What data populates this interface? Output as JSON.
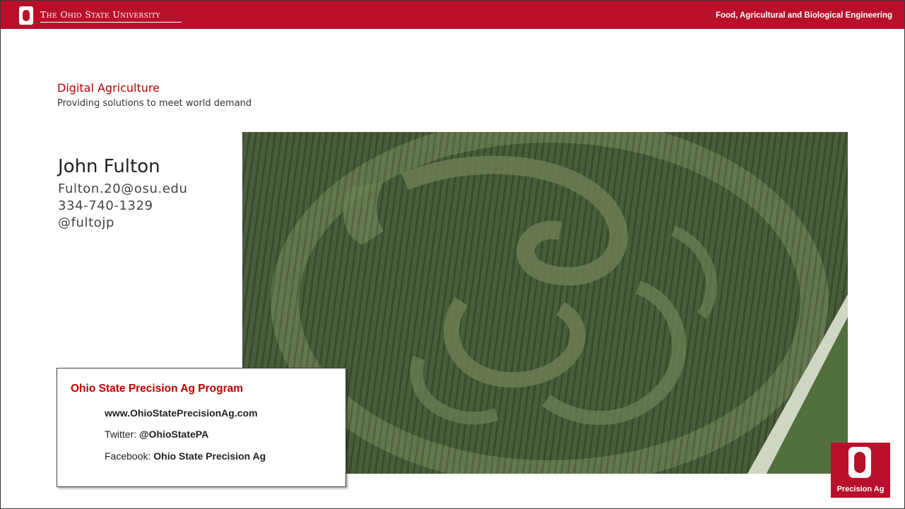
{
  "header": {
    "university": "The Ohio State University",
    "department": "Food, Agricultural and Biological Engineering"
  },
  "slide": {
    "title": "Digital Agriculture",
    "subtitle": "Providing solutions to meet world demand"
  },
  "contact": {
    "name": "John Fulton",
    "email": "Fulton.20@osu.edu",
    "phone": "334-740-1329",
    "handle": "@fultojp"
  },
  "program": {
    "heading": "Ohio State Precision Ag Program",
    "website": "www.OhioStatePrecisionAg.com",
    "twitter_label": "Twitter: ",
    "twitter_value": "@OhioStatePA",
    "facebook_label": "Facebook: ",
    "facebook_value": "Ohio State Precision Ag"
  },
  "logo": {
    "text": "Precision Ag"
  },
  "colors": {
    "scarlet": "#b8102a",
    "accent_text": "#bb0000"
  },
  "icons": {
    "header_logo": "block-o-logo-icon",
    "corner_logo": "precision-ag-logo-icon"
  }
}
